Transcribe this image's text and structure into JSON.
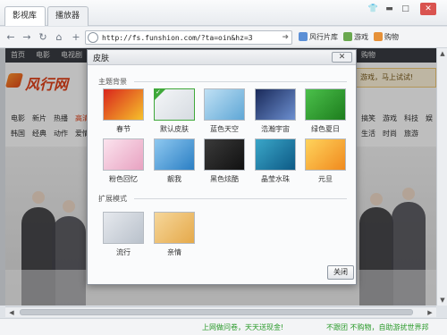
{
  "browser": {
    "tabs": [
      {
        "label": "影视库"
      },
      {
        "label": "播放器"
      }
    ],
    "window_controls": [
      "shirt-icon",
      "minimize-icon",
      "maximize-icon",
      "close-icon"
    ],
    "nav_icons": [
      "back-arrow-icon",
      "forward-arrow-icon",
      "refresh-icon",
      "home-icon",
      "plus-icon"
    ],
    "address": {
      "url": "http://fs.funshion.com/?ta=oin&hz=3"
    },
    "favorites": [
      {
        "label": "风行片库",
        "icon": "grid-icon",
        "color": "#5b8fd6"
      },
      {
        "label": "游戏",
        "icon": "gamepad-icon",
        "color": "#6aa84f"
      },
      {
        "label": "购物",
        "icon": "bag-icon",
        "color": "#e69138"
      }
    ]
  },
  "site": {
    "nav": [
      "首页",
      "电影",
      "电视剧",
      "购物"
    ],
    "logo_text": "风行网",
    "promo": "游戏，马上试试!",
    "row1": [
      "电影",
      "新片",
      "热播",
      "高清",
      "搞笑",
      "游戏",
      "科技",
      "娱"
    ],
    "row2": [
      "韩国",
      "经典",
      "动作",
      "爱情",
      "生活",
      "时尚",
      "旅游"
    ]
  },
  "status": {
    "left": "上网做问卷，天天送现金!",
    "right": "不跟团 不购物，自助游扰世界邦"
  },
  "dialog": {
    "title": "皮肤",
    "close_label": "✕",
    "section1": "主题背景",
    "section2": "扩展模式",
    "theme_skins": [
      {
        "label": "春节",
        "colors": [
          "#d9251d",
          "#f6c12b"
        ],
        "selected": false
      },
      {
        "label": "默认皮肤",
        "colors": [
          "#f4f6f8",
          "#d6dbe1"
        ],
        "selected": true
      },
      {
        "label": "蓝色天空",
        "colors": [
          "#bfe0f4",
          "#5fa7d6"
        ],
        "selected": false
      },
      {
        "label": "浩瀚宇宙",
        "colors": [
          "#1a2a5a",
          "#6c8fd0"
        ],
        "selected": false
      },
      {
        "label": "绿色夏日",
        "colors": [
          "#4bc04b",
          "#1d7d1d"
        ],
        "selected": false
      },
      {
        "label": "粉色回忆",
        "colors": [
          "#fbe3ee",
          "#e8a2c1"
        ],
        "selected": false
      },
      {
        "label": "靓我",
        "colors": [
          "#8ec8f0",
          "#2b7fc4"
        ],
        "selected": false
      },
      {
        "label": "黑色炫酷",
        "colors": [
          "#3a3a3a",
          "#111111"
        ],
        "selected": false
      },
      {
        "label": "晶莹水珠",
        "colors": [
          "#3aa6c8",
          "#0d5a86"
        ],
        "selected": false
      },
      {
        "label": "元旦",
        "colors": [
          "#ffd35c",
          "#f08a1e"
        ],
        "selected": false
      }
    ],
    "ext_modes": [
      {
        "label": "流行",
        "colors": [
          "#e6e9ee",
          "#b9c1cb"
        ]
      },
      {
        "label": "亲情",
        "colors": [
          "#f6d79b",
          "#e5a94a"
        ]
      }
    ],
    "ok_label": "关闭"
  }
}
